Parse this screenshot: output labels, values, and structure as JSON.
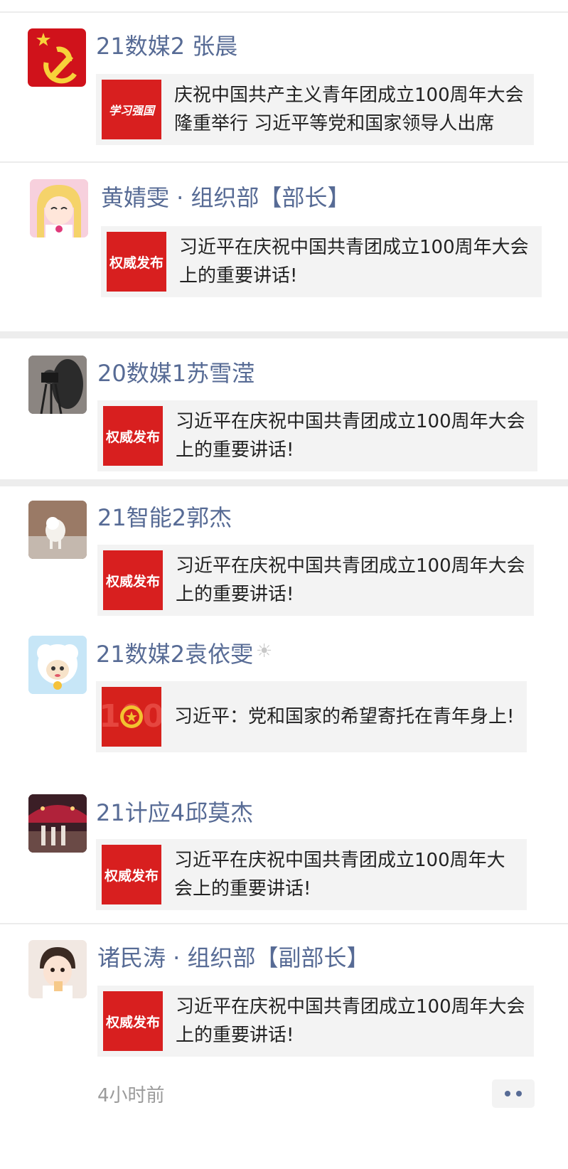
{
  "colors": {
    "name": "#576b95",
    "thumb_red": "#d81f1f",
    "card_bg": "#f3f3f3"
  },
  "posts": [
    {
      "name": "21数媒2 张晨",
      "thumb_label": "学习强国",
      "avatar": "party-flag-icon",
      "text": "庆祝中国共产主义青年团成立100周年大会隆重举行 习近平等党和国家领导人出席"
    },
    {
      "name": "黄婧雯 · 组织部【部长】",
      "thumb_label": "权威发布",
      "avatar": "anime-girl-avatar",
      "text": "习近平在庆祝中国共青团成立100周年大会上的重要讲话!"
    },
    {
      "name": "20数媒1苏雪滢",
      "thumb_label": "权威发布",
      "avatar": "photo-avatar",
      "text": "习近平在庆祝中国共青团成立100周年大会上的重要讲话!"
    },
    {
      "name": "21智能2郭杰",
      "thumb_label": "权威发布",
      "avatar": "dog-avatar",
      "text": "习近平在庆祝中国共青团成立100周年大会上的重要讲话!"
    },
    {
      "name": "21数媒2袁依雯",
      "thumb_label": "",
      "avatar": "sheep-cartoon-avatar",
      "text": "习近平：党和国家的希望寄托在青年身上!"
    },
    {
      "name": "21计应4邱莫杰",
      "thumb_label": "权威发布",
      "avatar": "stage-photo-avatar",
      "text": "习近平在庆祝中国共青团成立100周年大会上的重要讲话!"
    },
    {
      "name": "诸民涛 · 组织部【副部长】",
      "thumb_label": "权威发布",
      "avatar": "child-photo-avatar",
      "text": "习近平在庆祝中国共青团成立100周年大会上的重要讲话!"
    }
  ],
  "footer": {
    "time": "4小时前"
  }
}
